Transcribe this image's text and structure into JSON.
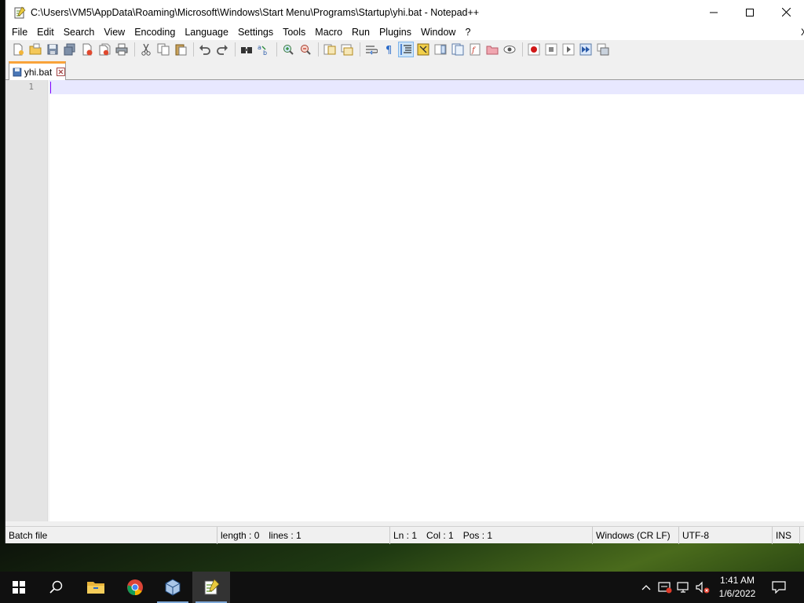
{
  "window": {
    "title": "C:\\Users\\VM5\\AppData\\Roaming\\Microsoft\\Windows\\Start Menu\\Programs\\Startup\\yhi.bat - Notepad++",
    "controls": {
      "minimize": "—",
      "maximize": "☐",
      "close": "✕"
    }
  },
  "menu": {
    "items": [
      "File",
      "Edit",
      "Search",
      "View",
      "Encoding",
      "Language",
      "Settings",
      "Tools",
      "Macro",
      "Run",
      "Plugins",
      "Window",
      "?"
    ],
    "close_doc": "X"
  },
  "toolbar": {
    "icons": [
      "new-file-icon",
      "open-file-icon",
      "save-icon",
      "save-all-icon",
      "close-icon",
      "close-all-icon",
      "print-icon",
      "cut-icon",
      "copy-icon",
      "paste-icon",
      "undo-icon",
      "redo-icon",
      "find-icon",
      "replace-icon",
      "zoom-in-icon",
      "zoom-out-icon",
      "sync-vertical-icon",
      "sync-horizontal-icon",
      "word-wrap-icon",
      "show-all-chars-icon",
      "indent-guide-icon",
      "user-language-icon",
      "doc-map-icon",
      "doc-list-icon",
      "function-list-icon",
      "folder-as-workspace-icon",
      "monitoring-icon",
      "record-macro-icon",
      "stop-record-icon",
      "playback-icon",
      "run-macro-multiple-icon",
      "save-macro-icon"
    ]
  },
  "tab": {
    "label": "yhi.bat"
  },
  "editor": {
    "line_numbers": [
      "1"
    ],
    "content": ""
  },
  "status": {
    "file_type": "Batch file",
    "length": "length : 0",
    "lines": "lines : 1",
    "ln": "Ln : 1",
    "col": "Col : 1",
    "pos": "Pos : 1",
    "eol": "Windows (CR LF)",
    "encoding": "UTF-8",
    "mode": "INS"
  },
  "taskbar": {
    "apps": [
      "start-icon",
      "search-icon",
      "file-explorer-icon",
      "chrome-icon",
      "virtualbox-icon",
      "notepadpp-icon"
    ],
    "clock": {
      "time": "1:41 AM",
      "date": "1/6/2022"
    }
  },
  "colors": {
    "tab_accent": "#f9a33a",
    "current_line": "#e8e8ff",
    "caret": "#8000ff"
  }
}
